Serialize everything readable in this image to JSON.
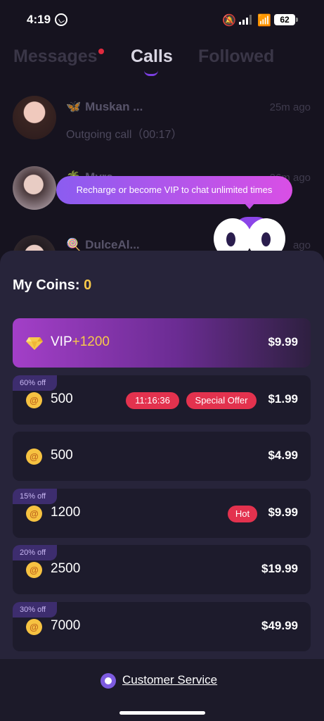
{
  "status_bar": {
    "time": "4:19",
    "battery": "62"
  },
  "tabs": [
    {
      "label": "Messages"
    },
    {
      "label": "Calls"
    },
    {
      "label": "Followed"
    }
  ],
  "calls": [
    {
      "emoji": "🦋",
      "name": "Muskan ...",
      "detail": "Outgoing call（00:17）",
      "time": "25m ago"
    },
    {
      "emoji": "🌴",
      "name": "Myra...",
      "detail": "",
      "time": "26m ago"
    },
    {
      "emoji": "🍭",
      "name": "DulceAl...",
      "detail": "",
      "time": "ago"
    }
  ],
  "tooltip": {
    "text": "Recharge or become VIP to chat unlimited times"
  },
  "sheet": {
    "coins_label": "My Coins:",
    "coins_value": "0"
  },
  "packages": [
    {
      "type": "vip",
      "label": "VIP",
      "bonus": "+1200",
      "price": "$9.99"
    },
    {
      "amount": "500",
      "price": "$1.99",
      "discount": "60% off",
      "timer": "11:16:36",
      "badge": "Special Offer"
    },
    {
      "amount": "500",
      "price": "$4.99"
    },
    {
      "amount": "1200",
      "price": "$9.99",
      "discount": "15% off",
      "badge": "Hot"
    },
    {
      "amount": "2500",
      "price": "$19.99",
      "discount": "20% off"
    },
    {
      "amount": "7000",
      "price": "$49.99",
      "discount": "30% off"
    }
  ],
  "footer": {
    "customer_service": "Customer Service"
  }
}
